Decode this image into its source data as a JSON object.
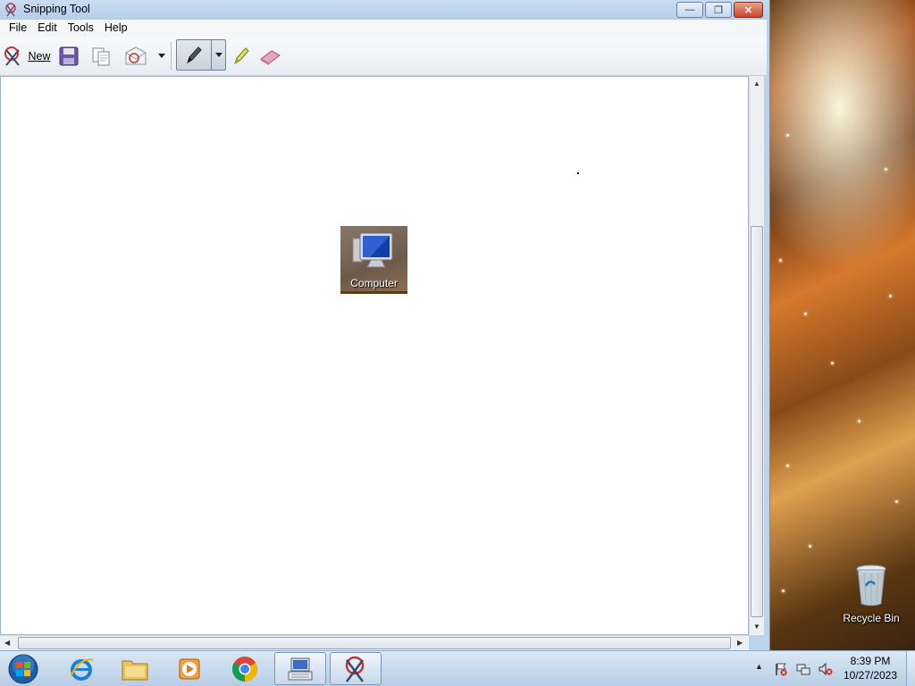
{
  "window": {
    "title": "Snipping Tool",
    "controls": {
      "minimize": "—",
      "restore": "❐",
      "close": "✕"
    }
  },
  "menu": [
    "File",
    "Edit",
    "Tools",
    "Help"
  ],
  "toolbar": {
    "new_label": "New",
    "icons": [
      "new-snip-icon",
      "save-icon",
      "copy-icon",
      "send-snip-icon",
      "dropdown-arrow-icon",
      "pen-icon",
      "highlighter-icon",
      "eraser-icon"
    ]
  },
  "canvas": {
    "snip_label": "Computer"
  },
  "desktop": {
    "recycle_bin_label": "Recycle Bin"
  },
  "taskbar": {
    "apps": [
      "start-orb",
      "internet-explorer",
      "file-explorer",
      "media-player",
      "chrome",
      "keyboard-app",
      "snipping-tool"
    ],
    "tray": {
      "time": "8:39 PM",
      "date": "10/27/2023",
      "icons": [
        "show-hidden-icons",
        "action-center-flag-icon",
        "network-icon",
        "volume-muted-icon"
      ]
    }
  },
  "colors": {
    "titlebar": "#bcd3ec",
    "close_button": "#c9462a",
    "taskbar": "#c7d8eb"
  }
}
